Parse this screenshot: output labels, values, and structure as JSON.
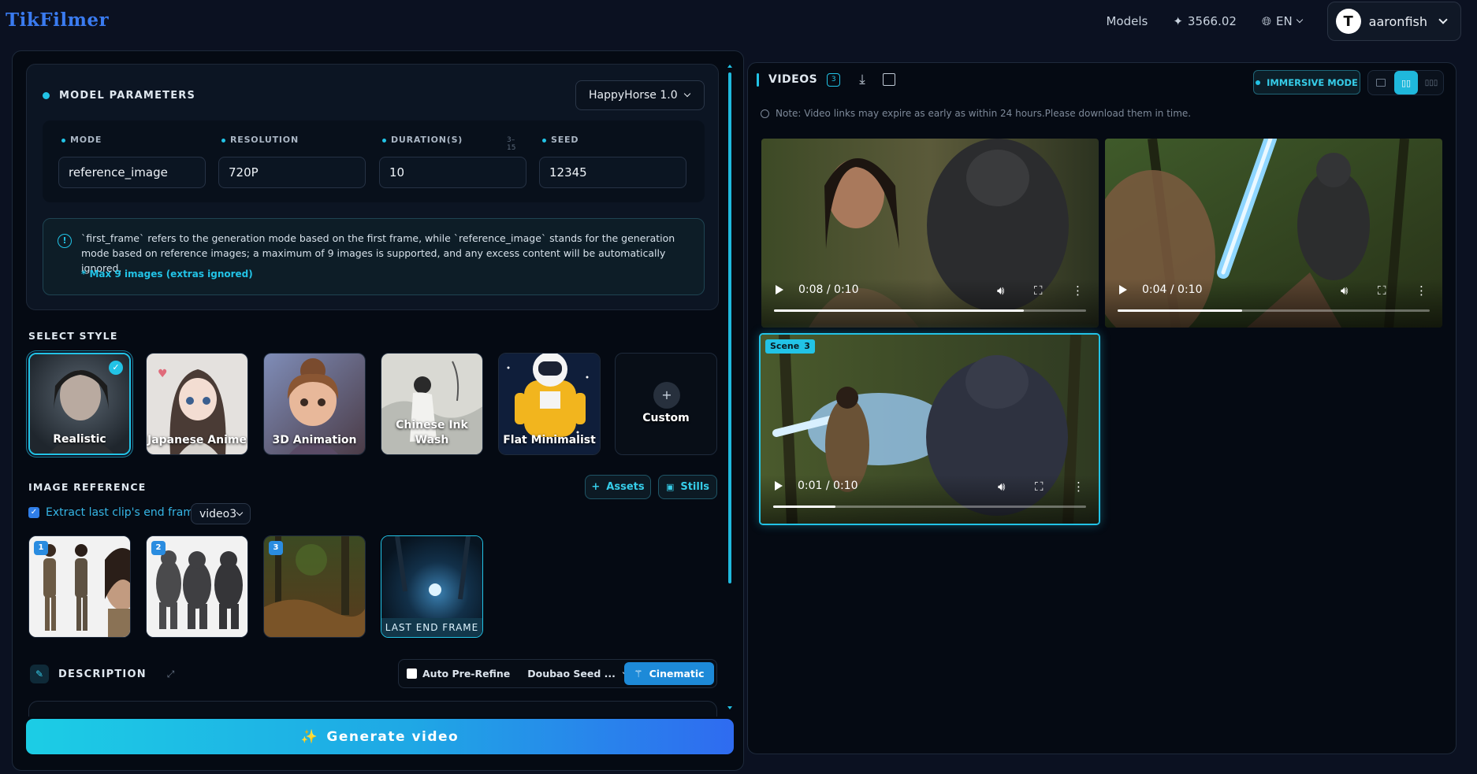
{
  "brand": "TikFilmer",
  "topnav": {
    "models": "Models",
    "credits": "3566.02",
    "language": "EN",
    "avatar_letter": "T",
    "username": "aaronfish"
  },
  "model_params": {
    "title": "MODEL PARAMETERS",
    "model_select": "HappyHorse 1.0",
    "fields": [
      {
        "label": "MODE",
        "value": "reference_image"
      },
      {
        "label": "RESOLUTION",
        "value": "720P"
      },
      {
        "label": "DURATION(S)",
        "value": "10",
        "hint": "3–15"
      },
      {
        "label": "SEED",
        "value": "12345"
      }
    ],
    "note": "`first_frame` refers to the generation mode based on the first frame, while `reference_image` stands for the generation mode based on reference images; a maximum of 9 images is supported, and any excess content will be automatically ignored.",
    "note_highlight": "* Max 9 images (extras ignored)"
  },
  "style": {
    "title": "SELECT STYLE",
    "items": [
      {
        "label": "Realistic",
        "selected": true
      },
      {
        "label": "Japanese Anime",
        "selected": false
      },
      {
        "label": "3D Animation",
        "selected": false
      },
      {
        "label": "Chinese Ink Wash",
        "selected": false
      },
      {
        "label": "Flat Minimalist",
        "selected": false
      },
      {
        "label": "Custom",
        "selected": false
      }
    ]
  },
  "image_reference": {
    "title": "IMAGE REFERENCE",
    "assets_label": "Assets",
    "stills_label": "Stills",
    "extract_label": "Extract last clip's end frame",
    "extract_checked": true,
    "clip_select": "video3",
    "cards": [
      {
        "badge": "1"
      },
      {
        "badge": "2"
      },
      {
        "badge": "3"
      },
      {
        "label": "LAST END FRAME"
      }
    ]
  },
  "description": {
    "title": "DESCRIPTION",
    "auto_refine": "Auto Pre-Refine",
    "refine_model": "Doubao Seed ...",
    "cinematic": "Cinematic"
  },
  "generate_label": "Generate video",
  "videos": {
    "title": "VIDEOS",
    "count": "3",
    "immersive": "IMMERSIVE MODE",
    "note": "Note: Video links may expire as early as within 24 hours.Please download them in time.",
    "items": [
      {
        "time": "0:08 / 0:10",
        "progress": 0.8
      },
      {
        "time": "0:04 / 0:10",
        "progress": 0.4
      },
      {
        "time": "0:01 / 0:10",
        "progress": 0.2,
        "scene_label": "Scene",
        "scene_num": "3"
      }
    ]
  },
  "colors": {
    "accent": "#22c3e6",
    "background": "#0b1121",
    "panel": "#050a13"
  }
}
